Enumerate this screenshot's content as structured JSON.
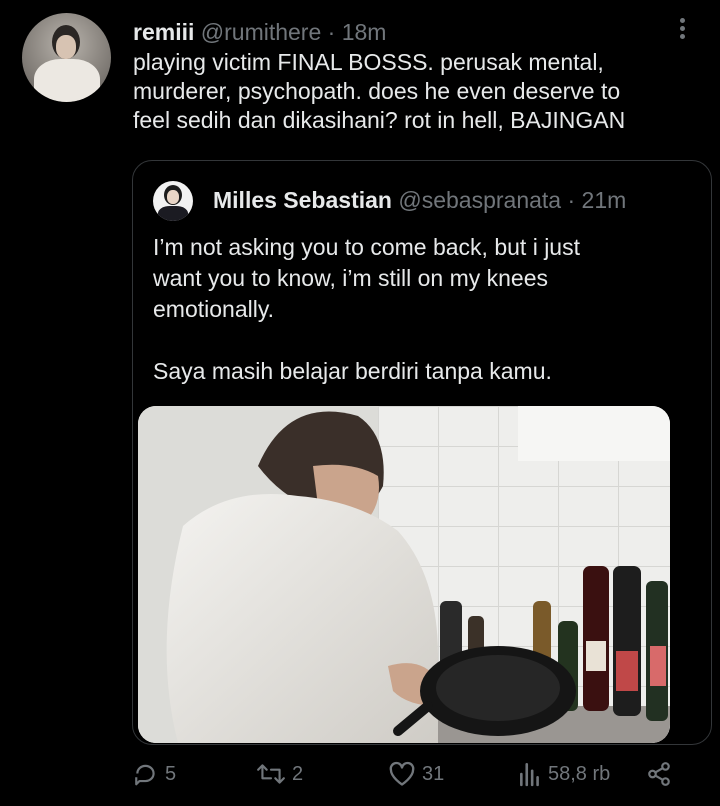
{
  "tweet": {
    "author_name": "remiii",
    "handle": "@rumithere",
    "separator": " · ",
    "time": "18m",
    "text": "playing victim FINAL BOSSS. perusak mental,\nmurderer, psychopath. does he even deserve to\nfeel sedih dan dikasihani? rot in hell, BAJINGAN"
  },
  "quote": {
    "author_name": "Milles Sebastian",
    "handle": "@sebaspranata",
    "separator": " · ",
    "time": "21m",
    "text": "I’m not asking you to come back, but i just\nwant you to know, i’m still on my knees\nemotionally.\n\nSaya masih belajar berdiri tanpa kamu."
  },
  "actions": {
    "reply_count": "5",
    "retweet_count": "2",
    "like_count": "31",
    "views_count": "58,8 rb"
  },
  "icons": {
    "reply": "reply-icon",
    "retweet": "retweet-icon",
    "like": "heart-icon",
    "views": "views-icon",
    "share": "share-icon",
    "more": "more-icon"
  },
  "colors": {
    "background": "#000000",
    "text": "#e7e9ea",
    "muted": "#71767b",
    "border": "#333639"
  }
}
